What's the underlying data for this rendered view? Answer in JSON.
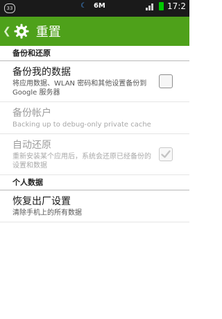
{
  "status_bar": {
    "notification_badge": "33",
    "memory": "6M",
    "time": "17:2"
  },
  "action_bar": {
    "title": "重置"
  },
  "sections": [
    {
      "header": "备份和还原"
    },
    {
      "header": "个人数据"
    }
  ],
  "prefs": {
    "backup": {
      "title": "备份我的数据",
      "summary": "将应用数据、WLAN 密码和其他设置备份到 Google 服务器",
      "checked": false,
      "enabled": true
    },
    "backup_account": {
      "title": "备份帐户",
      "summary": "Backing up to debug-only private cache",
      "enabled": false
    },
    "auto_restore": {
      "title": "自动还原",
      "summary": "重新安装某个应用后，系统会还原已经备份的设置和数据",
      "checked": true,
      "enabled": false
    },
    "factory_reset": {
      "title": "恢复出厂设置",
      "summary": "清除手机上的所有数据",
      "enabled": true
    }
  },
  "colors": {
    "action_bar": "#4ea11a",
    "status_bar": "#1a1a1a"
  }
}
